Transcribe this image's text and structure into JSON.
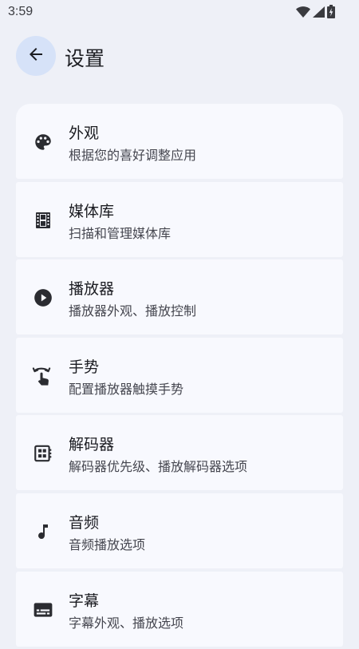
{
  "status_bar": {
    "time": "3:59",
    "icons": [
      "wifi-icon",
      "signal-icon",
      "battery-charging-icon"
    ]
  },
  "header": {
    "back_icon": "arrow-back-icon",
    "title": "设置"
  },
  "colors": {
    "background": "#eef0f7",
    "card": "#f8f9fe",
    "back_button_bg": "#d6e2f8",
    "icon": "#2b2c31",
    "title_text": "#1b1c21",
    "subtitle_text": "#45464f"
  },
  "settings": {
    "items": [
      {
        "icon": "palette-icon",
        "title": "外观",
        "subtitle": "根据您的喜好调整应用"
      },
      {
        "icon": "film-icon",
        "title": "媒体库",
        "subtitle": "扫描和管理媒体库"
      },
      {
        "icon": "play-circle-icon",
        "title": "播放器",
        "subtitle": "播放器外观、播放控制"
      },
      {
        "icon": "swipe-gesture-icon",
        "title": "手势",
        "subtitle": "配置播放器触摸手势"
      },
      {
        "icon": "decoder-icon",
        "title": "解码器",
        "subtitle": "解码器优先级、播放解码器选项"
      },
      {
        "icon": "music-note-icon",
        "title": "音频",
        "subtitle": "音频播放选项"
      },
      {
        "icon": "subtitles-icon",
        "title": "字幕",
        "subtitle": "字幕外观、播放选项"
      }
    ]
  }
}
